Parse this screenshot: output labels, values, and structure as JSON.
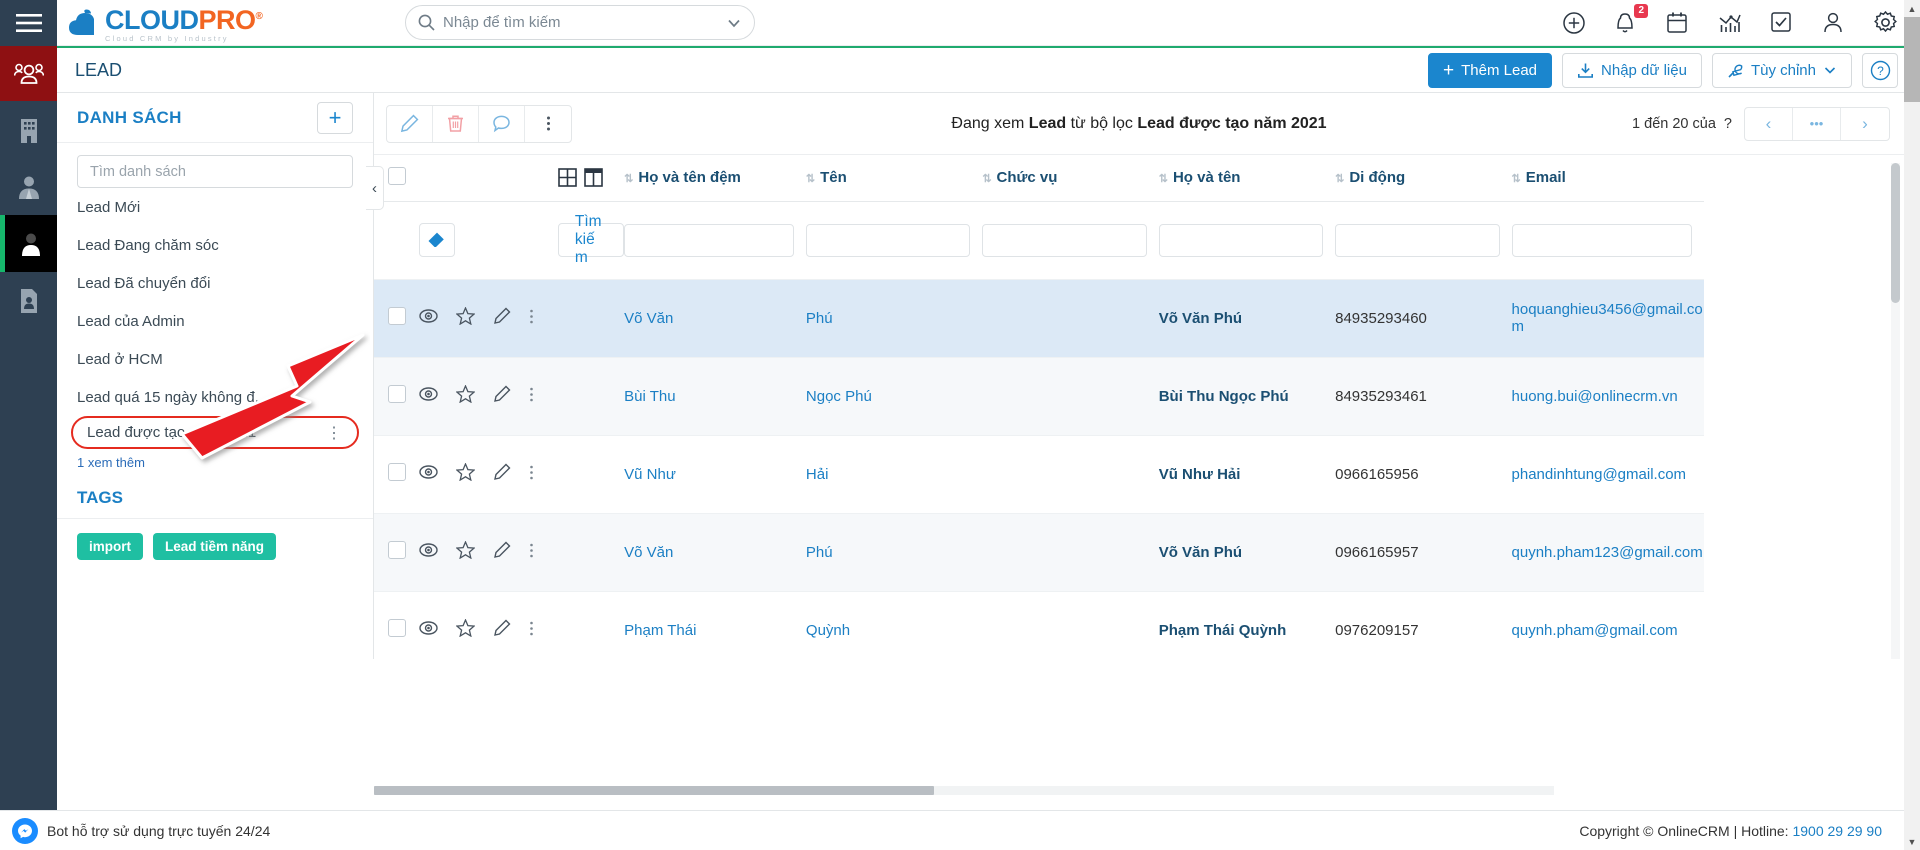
{
  "brand": {
    "name_part1": "CLOUD",
    "name_part2": "PRO",
    "registered": "®",
    "tagline": "Cloud CRM by Industry"
  },
  "search": {
    "placeholder": "Nhập để tìm kiếm",
    "value": "",
    "icon": "search-icon"
  },
  "topbar_icons": [
    {
      "name": "plus-circle-icon",
      "badge": ""
    },
    {
      "name": "bell-icon",
      "badge": "2"
    },
    {
      "name": "calendar-icon",
      "badge": ""
    },
    {
      "name": "chart-icon",
      "badge": ""
    },
    {
      "name": "checkbox-task-icon",
      "badge": ""
    },
    {
      "name": "user-icon",
      "badge": ""
    },
    {
      "name": "gear-icon",
      "badge": ""
    }
  ],
  "module": {
    "title": "LEAD",
    "actions": {
      "add_lead": "Thêm Lead",
      "import_data": "Nhập dữ liệu",
      "customize": "Tùy chỉnh",
      "help": "?"
    }
  },
  "sidebar": {
    "heading": "DANH SÁCH",
    "add_button": "+",
    "search_placeholder": "Tìm danh sách",
    "search_value": "",
    "items": [
      {
        "label": "Lead Mới",
        "selected": false
      },
      {
        "label": "Lead Đang chăm sóc",
        "selected": false
      },
      {
        "label": "Lead Đã chuyển đổi",
        "selected": false
      },
      {
        "label": "Lead của Admin",
        "selected": false
      },
      {
        "label": "Lead ở HCM",
        "selected": false
      },
      {
        "label": "Lead quá 15 ngày không đ..",
        "selected": false
      },
      {
        "label": "Lead được tạo năm 2021",
        "selected": true
      }
    ],
    "see_more": "1 xem thêm",
    "tags_heading": "TAGS",
    "tags": [
      "import",
      "Lead tiềm năng"
    ]
  },
  "main": {
    "toolbar_actions": [
      "edit-icon",
      "delete-icon",
      "comment-icon",
      "more-vertical-icon"
    ],
    "view_text_prefix": "Đang xem ",
    "view_text_entity": "Lead",
    "view_text_middle": " từ bộ lọc ",
    "view_text_filter": "Lead được tạo năm 2021",
    "pager_label": "1 đến 20 của",
    "pager_unknown": "?",
    "pager_prev": "‹",
    "pager_more": "•••",
    "pager_next": "›",
    "view_toggle_grid": "grid-view-icon",
    "view_toggle_split": "split-view-icon",
    "filter_clear": "eraser-icon",
    "filter_search": "Tìm kiếm",
    "columns": [
      "Họ và tên đệm",
      "Tên",
      "Chức vụ",
      "Họ và tên",
      "Di động",
      "Email"
    ],
    "filter_values": [
      "",
      "",
      "",
      "",
      "",
      ""
    ],
    "rows": [
      {
        "ho_ten_dem": "Võ Văn",
        "ten": "Phú",
        "chuc_vu": "",
        "ho_va_ten": "Võ Văn Phú",
        "di_dong": "84935293460",
        "email": "hoquanghieu3456@gmail.com",
        "highlight": true
      },
      {
        "ho_ten_dem": "Bùi Thu",
        "ten": "Ngọc Phú",
        "chuc_vu": "",
        "ho_va_ten": "Bùi Thu Ngọc Phú",
        "di_dong": "84935293461",
        "email": "huong.bui@onlinecrm.vn",
        "highlight": false
      },
      {
        "ho_ten_dem": "Vũ Như",
        "ten": "Hải",
        "chuc_vu": "",
        "ho_va_ten": "Vũ Như Hải",
        "di_dong": "0966165956",
        "email": "phandinhtung@gmail.com",
        "highlight": false
      },
      {
        "ho_ten_dem": "Võ Văn",
        "ten": "Phú",
        "chuc_vu": "",
        "ho_va_ten": "Võ Văn Phú",
        "di_dong": "0966165957",
        "email": "quynh.pham123@gmail.com",
        "highlight": false
      },
      {
        "ho_ten_dem": "Phạm Thái",
        "ten": "Quỳnh",
        "chuc_vu": "",
        "ho_va_ten": "Phạm Thái Quỳnh",
        "di_dong": "0976209157",
        "email": "quynh.pham@gmail.com",
        "highlight": false
      }
    ],
    "row_actions": [
      "view-eye-icon",
      "favorite-star-icon",
      "edit-pencil-icon",
      "more-vertical-icon"
    ]
  },
  "footer": {
    "chat_text": "Bot hỗ trợ sử dụng trực tuyến 24/24",
    "copyright": "Copyright © OnlineCRM | Hotline: ",
    "hotline": "1900 29 29 90"
  },
  "colors": {
    "accent_blue": "#1b86ce",
    "brand_orange": "#f26522",
    "rail_dark": "#2e4052",
    "rail_red": "#8e1012",
    "green_line": "#1faa6e",
    "tag_teal": "#1fbfa2",
    "annotation_red": "#e52b1f",
    "badge_red": "#e8384f"
  }
}
